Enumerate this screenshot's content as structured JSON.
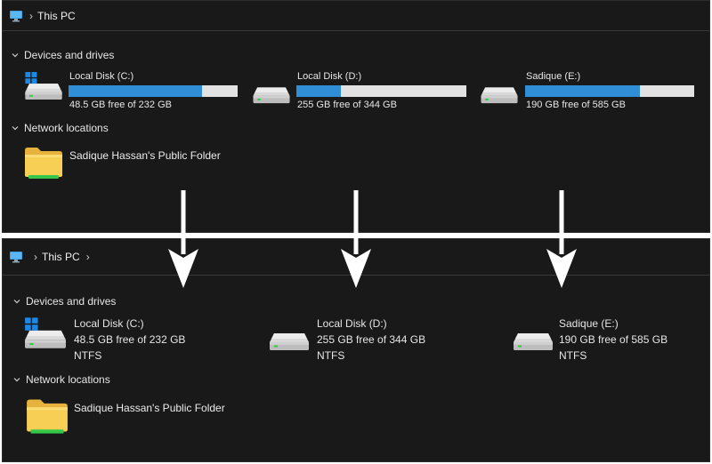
{
  "colors": {
    "background": "#191919",
    "accent_bar": "#2f8ed6",
    "bar_track": "#e2e2e2",
    "separator": "#ffffff"
  },
  "top": {
    "breadcrumb": [
      "This PC"
    ],
    "devices_header": "Devices and drives",
    "network_header": "Network locations",
    "drives": [
      {
        "name": "Local Disk (C:)",
        "free": "48.5 GB free of 232 GB",
        "used_fraction": 0.79,
        "icon": "windows-drive-icon"
      },
      {
        "name": "Local Disk (D:)",
        "free": "255 GB free of 344 GB",
        "used_fraction": 0.26,
        "icon": "drive-icon"
      },
      {
        "name": "Sadique (E:)",
        "free": "190 GB free of 585 GB",
        "used_fraction": 0.68,
        "icon": "drive-icon"
      }
    ],
    "network_folder": "Sadique Hassan's Public Folder"
  },
  "bottom": {
    "breadcrumb": [
      "This PC"
    ],
    "devices_header": "Devices and drives",
    "network_header": "Network locations",
    "drives": [
      {
        "name": "Local Disk (C:)",
        "free": "48.5 GB free of 232 GB",
        "fs": "NTFS",
        "icon": "windows-drive-icon"
      },
      {
        "name": "Local Disk (D:)",
        "free": "255 GB free of 344 GB",
        "fs": "NTFS",
        "icon": "drive-icon"
      },
      {
        "name": "Sadique (E:)",
        "free": "190 GB free of 585 GB",
        "fs": "NTFS",
        "icon": "drive-icon"
      }
    ],
    "network_folder": "Sadique Hassan's Public Folder"
  }
}
